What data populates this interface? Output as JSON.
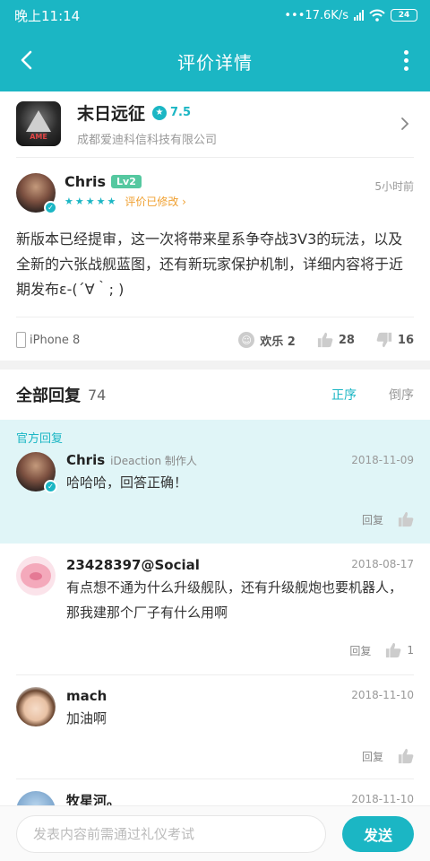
{
  "status": {
    "time": "晚上11:14",
    "speed": "•••17.6K/s",
    "battery": "24"
  },
  "header": {
    "title": "评价详情"
  },
  "game": {
    "name": "末日远征",
    "score": "7.5",
    "developer": "成都爱迪科信科技有限公司",
    "icon_text": "AME"
  },
  "review": {
    "user": "Chris",
    "level": "Lv2",
    "stars": "★★★★★",
    "edited": "评价已修改 ›",
    "time": "5小时前",
    "text": "新版本已经提审，这一次将带来星系争夺战3V3的玩法，以及全新的六张战舰蓝图，还有新玩家保护机制，详细内容将于近期发布ε-(´∀｀; )",
    "device": "iPhone 8",
    "fun_label": "欢乐 2",
    "likes": "28",
    "dislikes": "16"
  },
  "replies_head": {
    "title": "全部回复",
    "count": "74",
    "asc": "正序",
    "desc": "倒序"
  },
  "official": {
    "label": "官方回复",
    "user": "Chris",
    "role": "iDeaction 制作人",
    "date": "2018-11-09",
    "text": "哈哈哈，回答正确！",
    "reply_label": "回复"
  },
  "replies": [
    {
      "user": "23428397@Social",
      "date": "2018-08-17",
      "text": "有点想不通为什么升级舰队，还有升级舰炮也要机器人，那我建那个厂子有什么用啊",
      "reply_label": "回复",
      "likes": "1"
    },
    {
      "user": "mach",
      "date": "2018-11-10",
      "text": "加油啊",
      "reply_label": "回复"
    },
    {
      "user": "牧星河。",
      "date": "2018-11-10"
    }
  ],
  "input": {
    "placeholder": "发表内容前需通过礼仪考试",
    "send": "发送"
  },
  "colors": {
    "accent": "#1bb6c4",
    "official_bg": "#e0f5f7",
    "edited": "#f0a030",
    "level": "#55c8a0"
  }
}
